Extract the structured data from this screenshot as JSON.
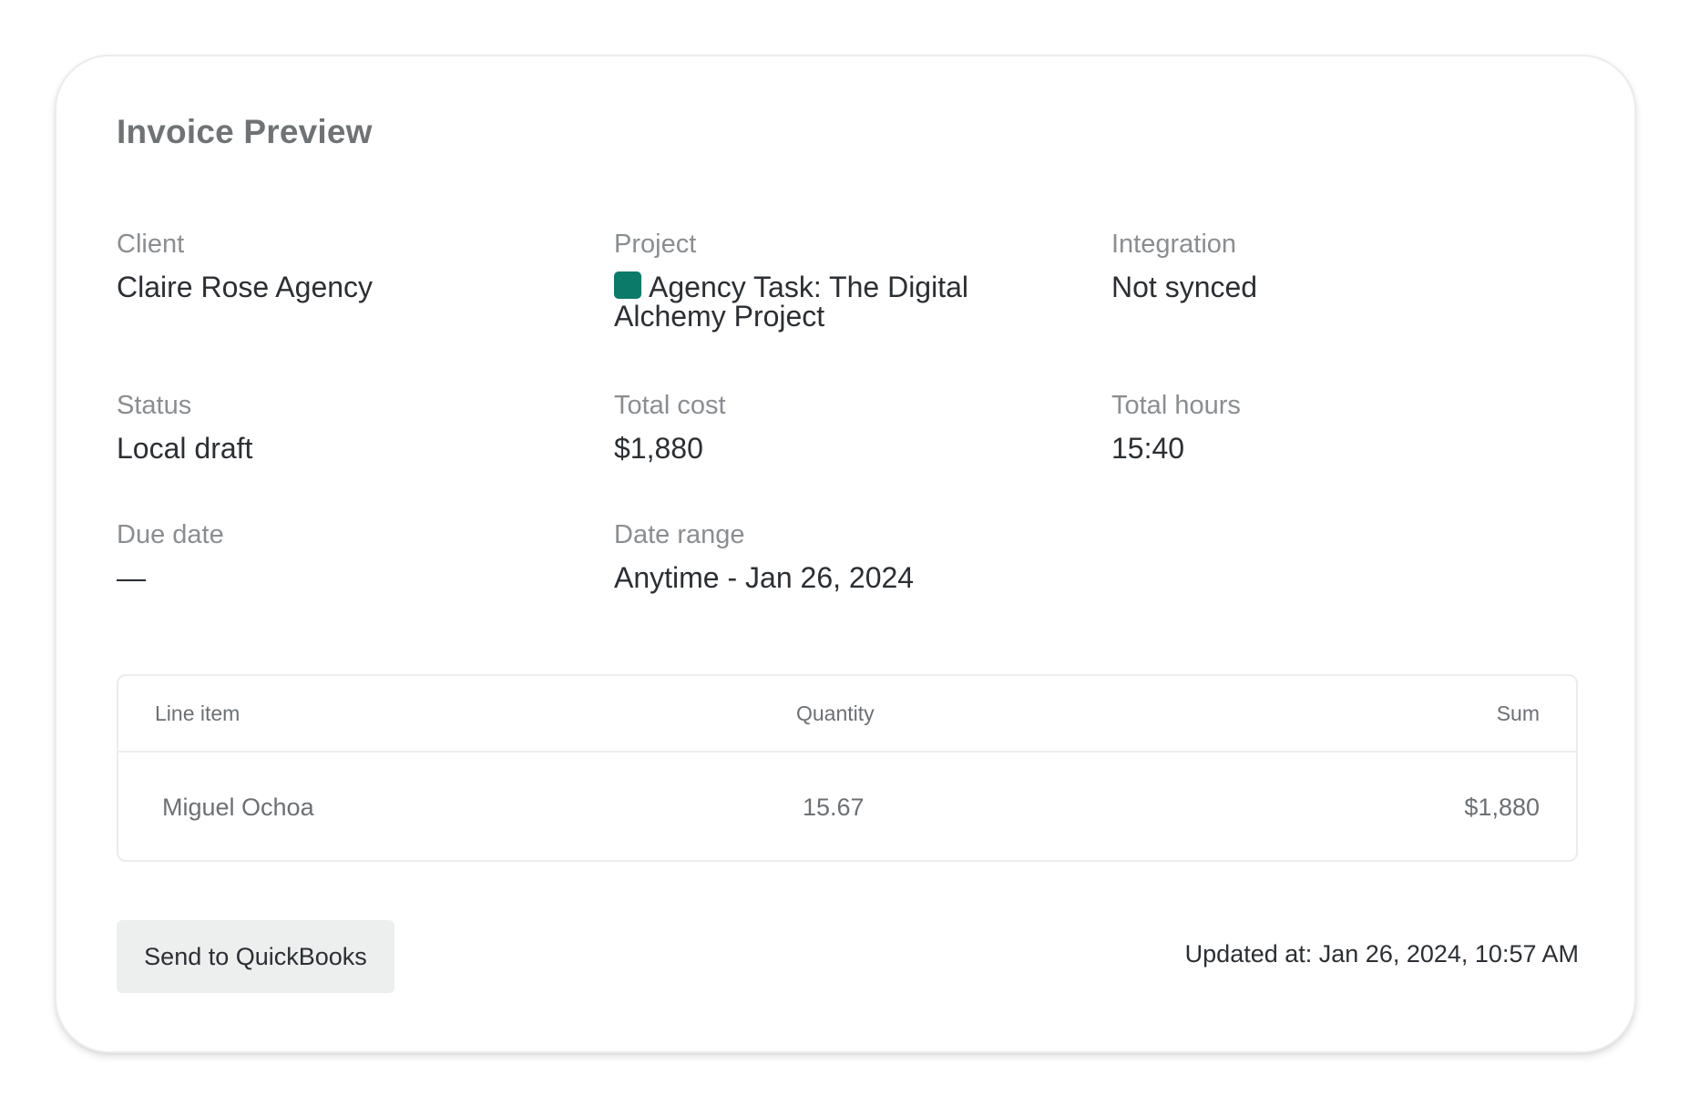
{
  "title": "Invoice Preview",
  "fields": {
    "client": {
      "label": "Client",
      "value": "Claire Rose Agency"
    },
    "project": {
      "label": "Project",
      "value": "Agency Task: The Digital Alchemy Project",
      "color": "#0b7a68"
    },
    "integration": {
      "label": "Integration",
      "value": "Not synced"
    },
    "status": {
      "label": "Status",
      "value": "Local draft"
    },
    "total_cost": {
      "label": "Total cost",
      "value": "$1,880"
    },
    "total_hours": {
      "label": "Total hours",
      "value": "15:40"
    },
    "due_date": {
      "label": "Due date",
      "value": "—"
    },
    "date_range": {
      "label": "Date range",
      "value": "Anytime - Jan 26, 2024"
    }
  },
  "table": {
    "headers": [
      "Line item",
      "Quantity",
      "Sum"
    ],
    "rows": [
      {
        "item": "Miguel Ochoa",
        "quantity": "15.67",
        "sum": "$1,880"
      }
    ]
  },
  "actions": {
    "send_label": "Send to QuickBooks"
  },
  "footer": {
    "updated": "Updated at: Jan 26, 2024, 10:57 AM"
  }
}
